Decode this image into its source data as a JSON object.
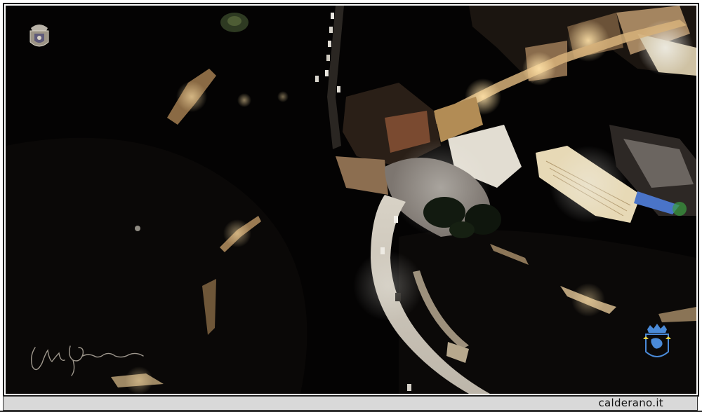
{
  "caption": {
    "site": "calderano.it"
  },
  "photo": {
    "subject": "aerial-night-town",
    "crest_top_left": "coat-of-arms-emblem",
    "crest_bottom_right": "blue-coat-of-arms-emblem",
    "signature": "handwritten-signature"
  },
  "colors": {
    "background": "#ffffff",
    "photo_dark": "#050404",
    "street_light": "#e8dcc4",
    "warm_light": "#c9935a",
    "caption_bar": "#d9d9d9",
    "crest_blue": "#3a7fd0"
  }
}
